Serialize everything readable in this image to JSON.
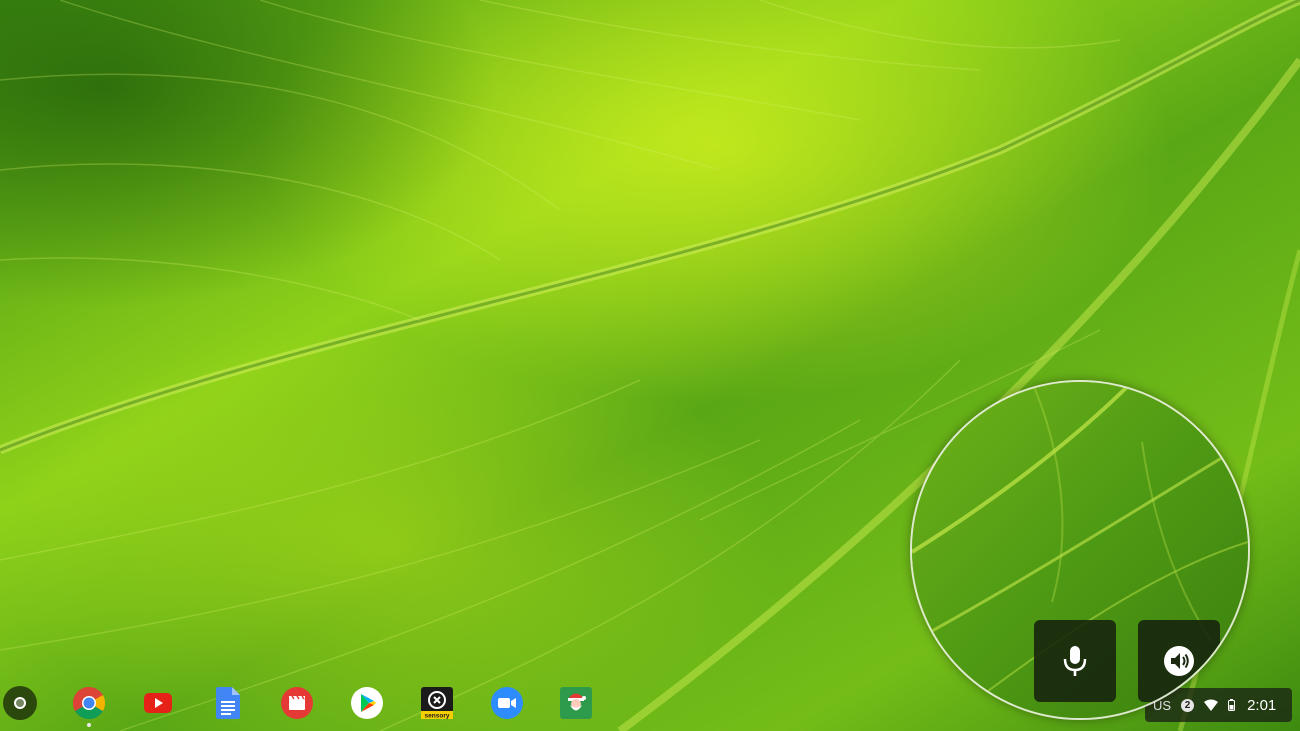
{
  "wallpaper": {
    "subject": "green leaf macro",
    "colors": {
      "light": "#b9e61c",
      "mid": "#63b01a",
      "dark": "#2f7410"
    }
  },
  "shelf": {
    "launcher": {
      "icon": "launcher-circle-icon"
    },
    "apps": [
      {
        "id": "chrome",
        "icon": "chrome-icon",
        "running": true
      },
      {
        "id": "youtube",
        "icon": "youtube-icon",
        "running": false
      },
      {
        "id": "docs",
        "icon": "docs-icon",
        "running": false
      },
      {
        "id": "video-player",
        "icon": "clapperboard-icon",
        "running": false
      },
      {
        "id": "play-store",
        "icon": "play-store-icon",
        "running": false
      },
      {
        "id": "sensory",
        "icon": "sensory-icon",
        "label": "sensory",
        "running": false
      },
      {
        "id": "zoom",
        "icon": "zoom-camera-icon",
        "running": false
      },
      {
        "id": "santa",
        "icon": "santa-icon",
        "running": false
      }
    ]
  },
  "tray": {
    "ime": "US",
    "notification_count": "2",
    "wifi_icon": "wifi-icon",
    "battery_icon": "battery-icon",
    "time": "2:01"
  },
  "magnifier": {
    "buttons": [
      {
        "id": "dictation",
        "icon": "microphone-icon"
      },
      {
        "id": "select-to-speak",
        "icon": "speak-icon"
      }
    ]
  }
}
